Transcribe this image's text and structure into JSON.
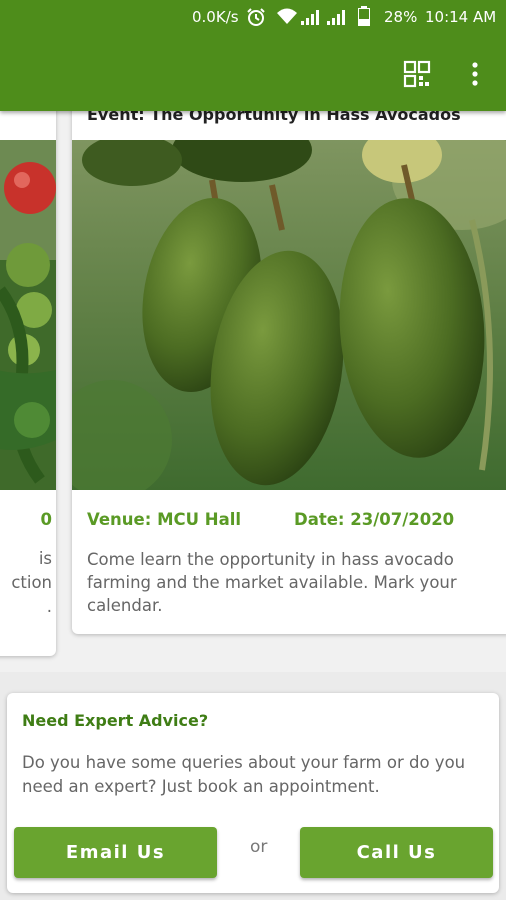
{
  "status_bar": {
    "speed": "0.0K/s",
    "battery": "28%",
    "time": "10:14 AM",
    "icons": [
      "alarm-icon",
      "wifi-icon",
      "signal-icon",
      "signal-icon",
      "battery-icon"
    ]
  },
  "toolbar": {
    "icons": [
      "qr-code-icon",
      "more-vert-icon"
    ]
  },
  "colors": {
    "appbar": "#4e8d1b",
    "accent_green": "#5a9a25",
    "button_green": "#69a42f",
    "title_green": "#3f7d15"
  },
  "event_card": {
    "title": "Event: The Opportunity in Hass Avocados",
    "image": "avocados-on-tree",
    "venue": "Venue: MCU Hall",
    "date": "Date: 23/07/2020",
    "description": "Come learn the opportunity in hass avocado farming and the market available. Mark your calendar."
  },
  "left_card": {
    "image": "tomatoes-on-vine",
    "fragments": [
      "0",
      "is",
      "ction",
      "."
    ]
  },
  "advice": {
    "title": "Need Expert Advice?",
    "description": "Do you have some queries about your farm or do you need an expert? Just book an appointment.",
    "email_button": "Email Us",
    "or_text": "or",
    "call_button": "Call Us"
  }
}
